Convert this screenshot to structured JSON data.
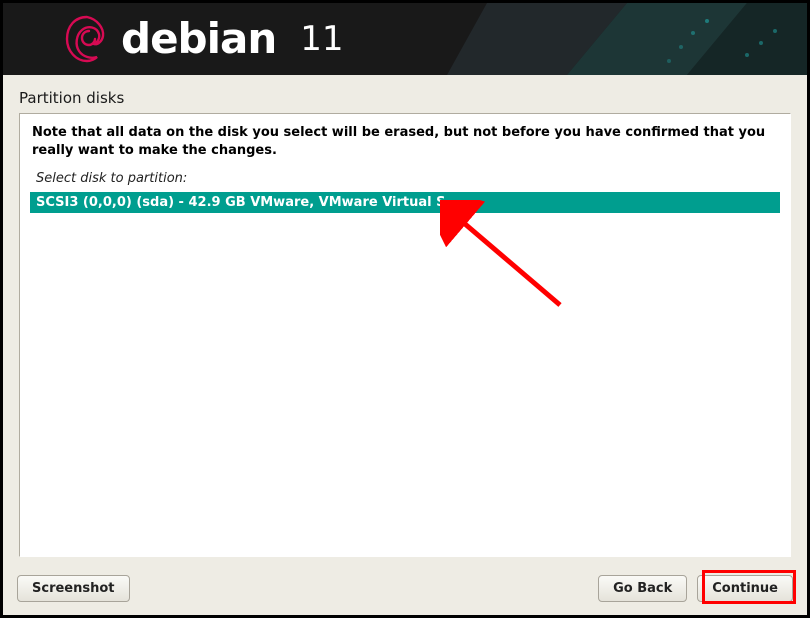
{
  "brand": {
    "name": "debian",
    "version": "11"
  },
  "page": {
    "title": "Partition disks"
  },
  "note_text": "Note that all data on the disk you select will be erased, but not before you have confirmed that you really want to make the changes.",
  "prompt_text": "Select disk to partition:",
  "disks": [
    {
      "label": "SCSI3 (0,0,0) (sda) - 42.9 GB VMware, VMware Virtual S"
    }
  ],
  "buttons": {
    "screenshot": "Screenshot",
    "go_back": "Go Back",
    "continue": "Continue"
  }
}
